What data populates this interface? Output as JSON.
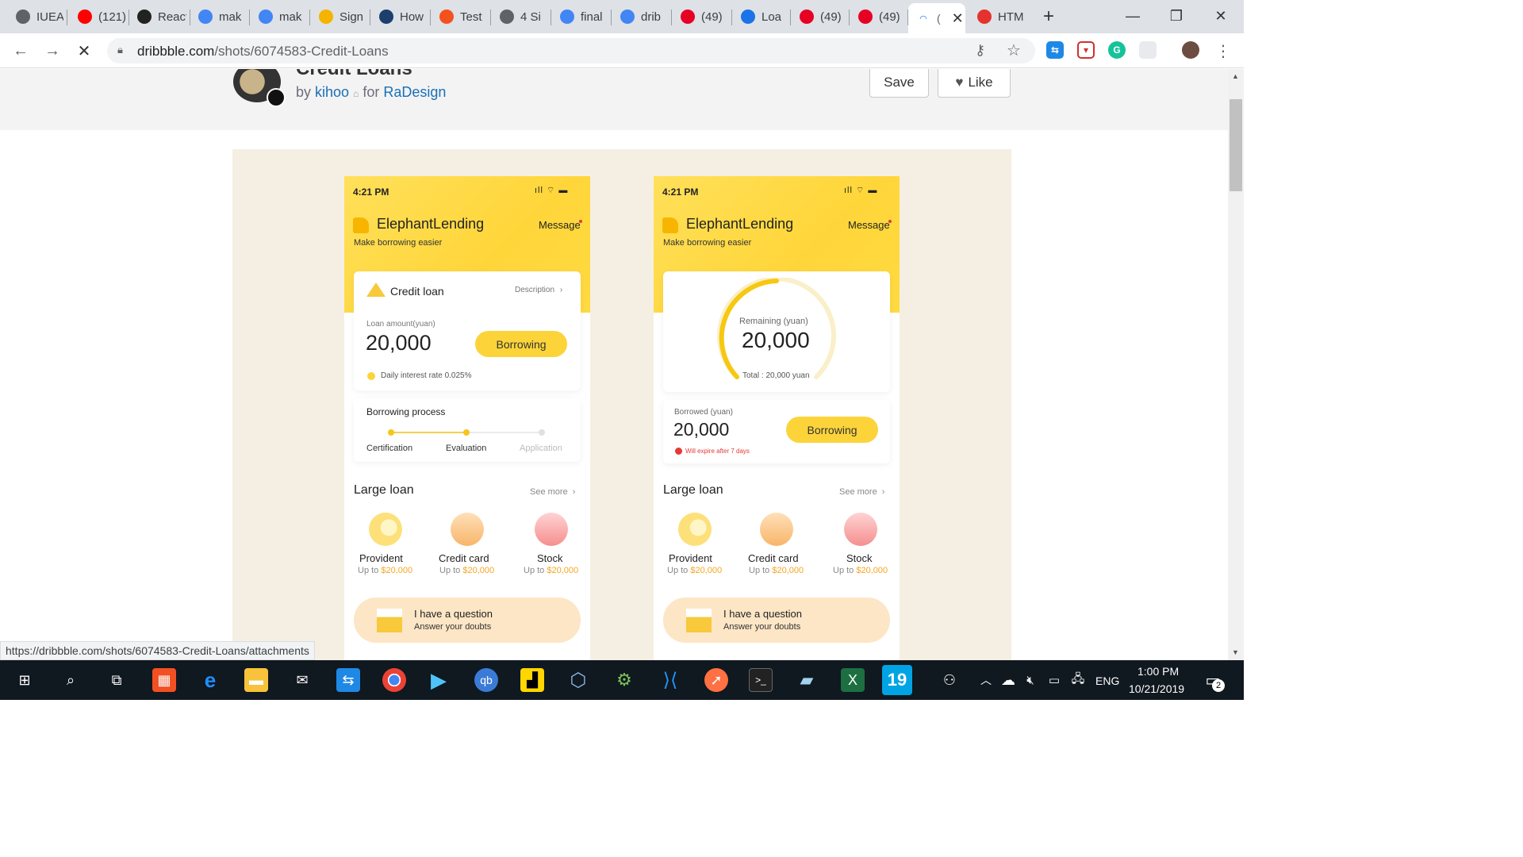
{
  "browser": {
    "tabs": [
      {
        "label": "IUEA",
        "icon": "globe-icon",
        "color": "#5f6368"
      },
      {
        "label": "(121)",
        "icon": "youtube-icon",
        "color": "#ff0000"
      },
      {
        "label": "React",
        "icon": "react-icon",
        "color": "#222222"
      },
      {
        "label": "mak",
        "icon": "google-icon",
        "color": "#4285f4"
      },
      {
        "label": "mak",
        "icon": "google-icon",
        "color": "#4285f4"
      },
      {
        "label": "Sign",
        "icon": "slides-icon",
        "color": "#f4b400"
      },
      {
        "label": "How",
        "icon": "bank-icon",
        "color": "#1c3f6e"
      },
      {
        "label": "Test",
        "icon": "test-icon",
        "color": "#f4511e"
      },
      {
        "label": "4 Si",
        "icon": "globe-icon",
        "color": "#5f6368"
      },
      {
        "label": "final",
        "icon": "google-icon",
        "color": "#4285f4"
      },
      {
        "label": "drib",
        "icon": "google-icon",
        "color": "#4285f4"
      },
      {
        "label": "(49)",
        "icon": "pinterest-icon",
        "color": "#e60023"
      },
      {
        "label": "Loa",
        "icon": "loading-icon",
        "color": "#1a73e8"
      },
      {
        "label": "(49)",
        "icon": "pinterest-icon",
        "color": "#e60023"
      },
      {
        "label": "(49)",
        "icon": "pinterest-icon",
        "color": "#e60023"
      },
      {
        "label": "",
        "icon": "loading-icon",
        "color": "#1a73e8"
      },
      {
        "label": "HTM",
        "icon": "opera-icon",
        "color": "#e5322d"
      }
    ],
    "url_host": "dribbble.com",
    "url_path": "/shots/6074583-Credit-Loans",
    "status_url": "https://dribbble.com/shots/6074583-Credit-Loans/attachments"
  },
  "shot": {
    "title": "Credit Loans",
    "by": "by",
    "author": "kihoo",
    "for": "for",
    "team": "RaDesign",
    "save_label": "Save",
    "like_label": "Like"
  },
  "phone_left": {
    "time": "4:21 PM",
    "brand": "ElephantLending",
    "message": "Message",
    "tagline": "Make borrowing easier",
    "card_title": "Credit loan",
    "description": "Description",
    "amount_label": "Loan amount(yuan)",
    "amount": "20,000",
    "button": "Borrowing",
    "rate": "Daily interest rate 0.025%",
    "process_title": "Borrowing process",
    "steps": [
      "Certification",
      "Evaluation",
      "Application"
    ],
    "progress": 0.5
  },
  "phone_right": {
    "time": "4:21 PM",
    "brand": "ElephantLending",
    "message": "Message",
    "tagline": "Make borrowing easier",
    "remaining_label": "Remaining (yuan)",
    "remaining": "20,000",
    "total": "Total : 20,000 yuan",
    "borrowed_label": "Borrowed (yuan)",
    "borrowed": "20,000",
    "button": "Borrowing",
    "expire": "Will expire after 7 days"
  },
  "large_loan": {
    "title": "Large loan",
    "see_more": "See more",
    "items": [
      {
        "name": "Provident",
        "prefix": "Up to ",
        "amount": "$20,000"
      },
      {
        "name": "Credit card",
        "prefix": "Up to ",
        "amount": "$20,000"
      },
      {
        "name": "Stock",
        "prefix": "Up to ",
        "amount": "$20,000"
      }
    ],
    "question_title": "I have a question",
    "question_sub": "Answer your doubts"
  },
  "taskbar": {
    "lang": "ENG",
    "time": "1:00 PM",
    "date": "10/21/2019",
    "notifications": "2",
    "badge_19": "19"
  },
  "colors": {
    "accent_yellow": "#fcd43a",
    "orange_amount": "#f5a623",
    "dribbble_link": "#1a6fb5",
    "shot_bg": "#f5efe3"
  }
}
